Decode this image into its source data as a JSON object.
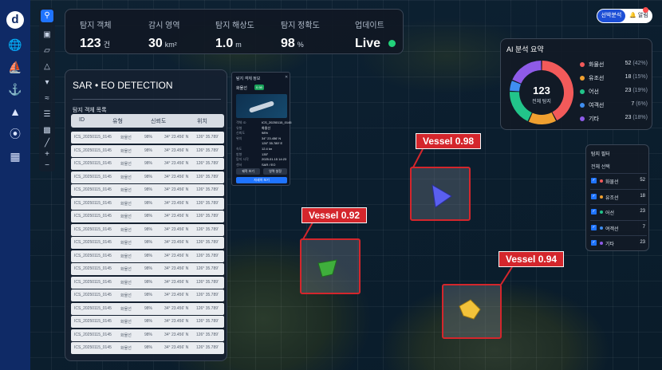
{
  "app": {
    "logo_glyph": "d"
  },
  "stats": [
    {
      "label": "탐지 객체",
      "value": "123",
      "unit": "건"
    },
    {
      "label": "감시 영역",
      "value": "30",
      "unit": "km²"
    },
    {
      "label": "탐지 해상도",
      "value": "1.0",
      "unit": "m"
    },
    {
      "label": "탐지 정확도",
      "value": "98",
      "unit": "%"
    },
    {
      "label": "업데이트",
      "value": "Live",
      "unit": ""
    }
  ],
  "topright": {
    "primary_label": "선박분석",
    "alert_label": "🔔 알림"
  },
  "panel": {
    "title": "SAR • EO DETECTION",
    "subtitle": "탐지 객체 목록",
    "columns": [
      "ID",
      "유형",
      "신뢰도",
      "위치"
    ],
    "rows": [
      [
        "ICS_20250115_0145",
        "화물선",
        "98%",
        "34° 23.456' N",
        "126° 35.789'"
      ],
      [
        "ICS_20250115_0145",
        "화물선",
        "98%",
        "34° 23.456' N",
        "126° 35.789'"
      ],
      [
        "ICS_20250115_0145",
        "화물선",
        "98%",
        "34° 23.456' N",
        "126° 35.789'"
      ],
      [
        "ICS_20250115_0145",
        "화물선",
        "98%",
        "34° 23.456' N",
        "126° 35.789'"
      ],
      [
        "ICS_20250115_0145",
        "화물선",
        "98%",
        "34° 23.456' N",
        "126° 35.789'"
      ],
      [
        "ICS_20250115_0145",
        "화물선",
        "98%",
        "34° 23.456' N",
        "126° 35.789'"
      ],
      [
        "ICS_20250115_0145",
        "화물선",
        "98%",
        "34° 23.456' N",
        "126° 35.789'"
      ],
      [
        "ICS_20250115_0145",
        "화물선",
        "98%",
        "34° 23.456' N",
        "126° 35.789'"
      ],
      [
        "ICS_20250115_0145",
        "화물선",
        "98%",
        "34° 23.456' N",
        "126° 35.789'"
      ],
      [
        "ICS_20250115_0145",
        "화물선",
        "98%",
        "34° 23.456' N",
        "126° 35.789'"
      ],
      [
        "ICS_20250115_0145",
        "화물선",
        "98%",
        "34° 23.456' N",
        "126° 35.789'"
      ],
      [
        "ICS_20250115_0145",
        "화물선",
        "98%",
        "34° 23.456' N",
        "126° 35.789'"
      ],
      [
        "ICS_20250115_0145",
        "화물선",
        "98%",
        "34° 23.456' N",
        "126° 35.789'"
      ],
      [
        "ICS_20250115_0145",
        "화물선",
        "98%",
        "34° 23.456' N",
        "126° 35.789'"
      ],
      [
        "ICS_20250115_0145",
        "화물선",
        "98%",
        "34° 23.456' N",
        "126° 35.789'"
      ],
      [
        "ICS_20250115_0145",
        "화물선",
        "98%",
        "34° 23.456' N",
        "126° 35.789'"
      ],
      [
        "ICS_20250115_0145",
        "화물선",
        "98%",
        "34° 23.456' N",
        "126° 35.789'"
      ]
    ]
  },
  "popup": {
    "title": "탐지 객체 정보",
    "id": "화물선",
    "tag": "0.98",
    "fields": [
      [
        "객체 ID",
        "ICS_20250115_0145"
      ],
      [
        "유형",
        "화물선"
      ],
      [
        "신뢰도",
        "98%"
      ],
      [
        "위치",
        "34° 23.456' N"
      ],
      [
        "",
        "126° 35.789' E"
      ],
      [
        "속도",
        "12.4 kn"
      ],
      [
        "방향",
        "135°"
      ],
      [
        "탐지 시각",
        "2025.01.15 14:23"
      ],
      [
        "센서",
        "SAR / EO"
      ]
    ],
    "btn_a": "궤적 보기",
    "btn_b": "영역 설정",
    "btn_primary": "자세히 보기"
  },
  "ai_summary": {
    "title": "AI 분석 요약",
    "total_value": "123",
    "total_label": "전체 탐지",
    "categories": [
      {
        "name": "화물선",
        "count": "52",
        "pct": "(42%)",
        "value": 52,
        "color": "#f25a5a"
      },
      {
        "name": "유조선",
        "count": "18",
        "pct": "(15%)",
        "value": 18,
        "color": "#f0a030"
      },
      {
        "name": "어선",
        "count": "23",
        "pct": "(19%)",
        "value": 23,
        "color": "#22c48a"
      },
      {
        "name": "여객선",
        "count": "7",
        "pct": "(6%)",
        "value": 7,
        "color": "#3f8ef0"
      },
      {
        "name": "기타",
        "count": "23",
        "pct": "(18%)",
        "value": 23,
        "color": "#8e5be8"
      }
    ]
  },
  "filter": {
    "title": "탐지 필터",
    "all_label": "전체 선택",
    "items": [
      {
        "name": "화물선",
        "count": "52",
        "color": "#f25a5a"
      },
      {
        "name": "유조선",
        "count": "18",
        "color": "#f0a030"
      },
      {
        "name": "어선",
        "count": "23",
        "color": "#22c48a"
      },
      {
        "name": "여객선",
        "count": "7",
        "color": "#3f8ef0"
      },
      {
        "name": "기타",
        "count": "23",
        "color": "#8e5be8"
      }
    ]
  },
  "detections": [
    {
      "label": "Vessel 0.98",
      "color": "#5a5ff0"
    },
    {
      "label": "Vessel 0.92",
      "color": "#3fae3c"
    },
    {
      "label": "Vessel 0.94",
      "color": "#f2c23a"
    }
  ]
}
